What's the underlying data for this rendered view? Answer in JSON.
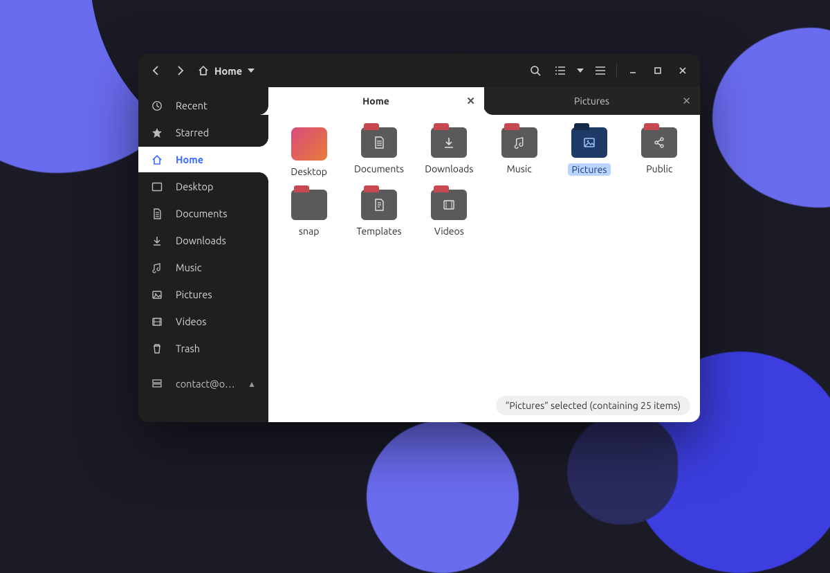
{
  "breadcrumb": {
    "location": "Home"
  },
  "tabs": [
    {
      "label": "Home",
      "active": true
    },
    {
      "label": "Pictures",
      "active": false
    }
  ],
  "sidebar": {
    "items": [
      {
        "id": "recent",
        "label": "Recent",
        "icon": "clock-icon"
      },
      {
        "id": "starred",
        "label": "Starred",
        "icon": "star-icon"
      },
      {
        "id": "home",
        "label": "Home",
        "icon": "home-icon",
        "active": true
      },
      {
        "id": "desktop",
        "label": "Desktop",
        "icon": "desktop-icon"
      },
      {
        "id": "documents",
        "label": "Documents",
        "icon": "document-icon"
      },
      {
        "id": "downloads",
        "label": "Downloads",
        "icon": "download-icon"
      },
      {
        "id": "music",
        "label": "Music",
        "icon": "music-icon"
      },
      {
        "id": "pictures",
        "label": "Pictures",
        "icon": "picture-icon"
      },
      {
        "id": "videos",
        "label": "Videos",
        "icon": "video-icon"
      },
      {
        "id": "trash",
        "label": "Trash",
        "icon": "trash-icon"
      }
    ],
    "mounts": [
      {
        "id": "contact",
        "label": "contact@o…",
        "icon": "server-icon",
        "ejectable": true
      }
    ]
  },
  "files": [
    {
      "name": "Desktop",
      "kind": "desktop",
      "icon": ""
    },
    {
      "name": "Documents",
      "kind": "folder",
      "icon": "doc"
    },
    {
      "name": "Downloads",
      "kind": "folder",
      "icon": "download"
    },
    {
      "name": "Music",
      "kind": "folder",
      "icon": "music"
    },
    {
      "name": "Pictures",
      "kind": "folder",
      "icon": "picture",
      "selected": true
    },
    {
      "name": "Public",
      "kind": "folder",
      "icon": "share"
    },
    {
      "name": "snap",
      "kind": "folder",
      "icon": ""
    },
    {
      "name": "Templates",
      "kind": "folder",
      "icon": "template"
    },
    {
      "name": "Videos",
      "kind": "folder",
      "icon": "video"
    }
  ],
  "status": {
    "text": "“Pictures” selected  (containing 25 items)"
  }
}
